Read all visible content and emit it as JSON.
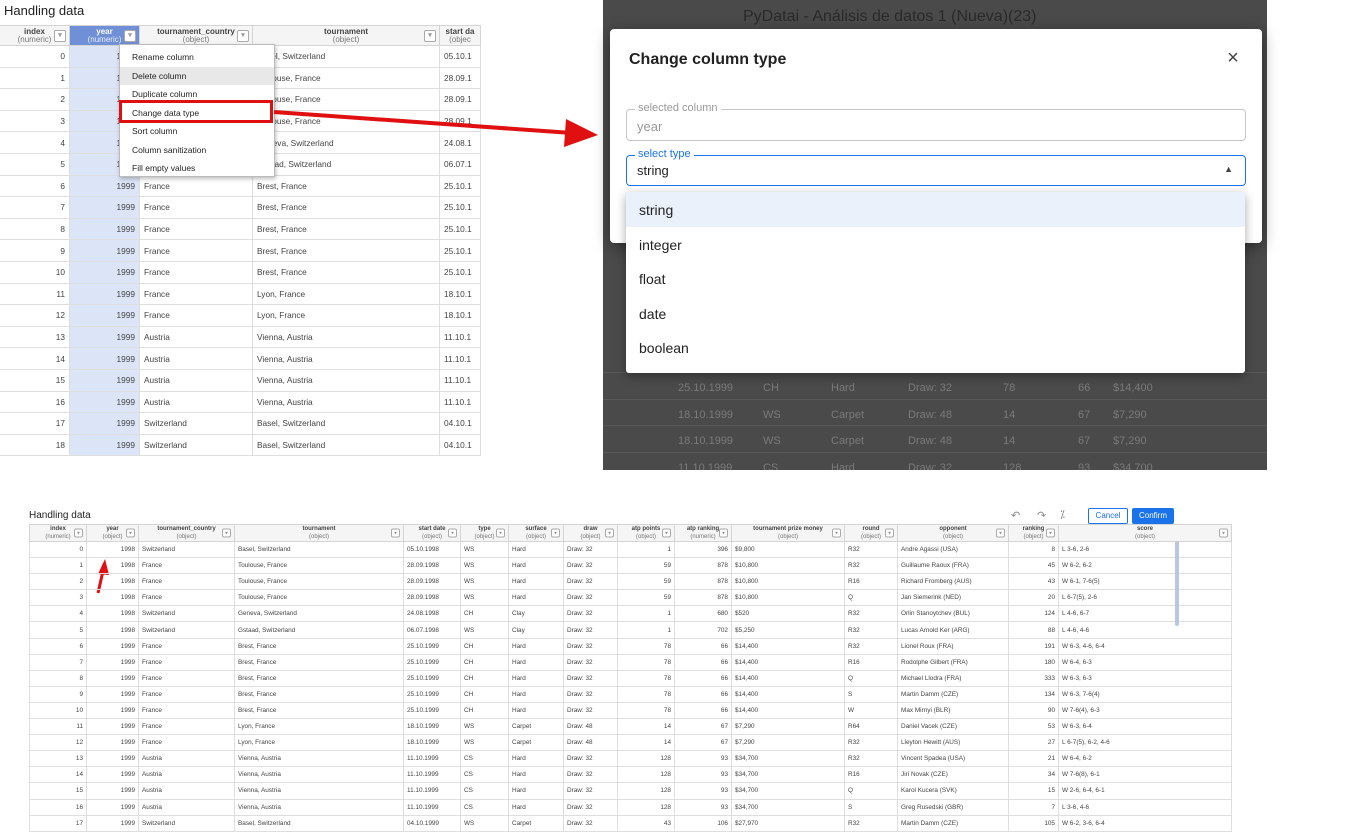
{
  "top_left": {
    "title": "Handling data",
    "columns": [
      {
        "name": "index",
        "type": "(numeric)"
      },
      {
        "name": "year",
        "type": "(numeric)"
      },
      {
        "name": "tournament_country",
        "type": "(object)"
      },
      {
        "name": "tournament",
        "type": "(object)"
      },
      {
        "name": "start da",
        "type": "(objec"
      }
    ],
    "rows": [
      [
        "0",
        "1998",
        "Switzerland",
        "Basel, Switzerland",
        "05.10.1"
      ],
      [
        "1",
        "1998",
        "France",
        "Toulouse, France",
        "28.09.1"
      ],
      [
        "2",
        "1998",
        "France",
        "Toulouse, France",
        "28.09.1"
      ],
      [
        "3",
        "1998",
        "France",
        "Toulouse, France",
        "28.09.1"
      ],
      [
        "4",
        "1998",
        "Switzerland",
        "Geneva, Switzerland",
        "24.08.1"
      ],
      [
        "5",
        "1998",
        "Switzerland",
        "Gstaad, Switzerland",
        "06.07.1"
      ],
      [
        "6",
        "1999",
        "France",
        "Brest, France",
        "25.10.1"
      ],
      [
        "7",
        "1999",
        "France",
        "Brest, France",
        "25.10.1"
      ],
      [
        "8",
        "1999",
        "France",
        "Brest, France",
        "25.10.1"
      ],
      [
        "9",
        "1999",
        "France",
        "Brest, France",
        "25.10.1"
      ],
      [
        "10",
        "1999",
        "France",
        "Brest, France",
        "25.10.1"
      ],
      [
        "11",
        "1999",
        "France",
        "Lyon, France",
        "18.10.1"
      ],
      [
        "12",
        "1999",
        "France",
        "Lyon, France",
        "18.10.1"
      ],
      [
        "13",
        "1999",
        "Austria",
        "Vienna, Austria",
        "11.10.1"
      ],
      [
        "14",
        "1999",
        "Austria",
        "Vienna, Austria",
        "11.10.1"
      ],
      [
        "15",
        "1999",
        "Austria",
        "Vienna, Austria",
        "11.10.1"
      ],
      [
        "16",
        "1999",
        "Austria",
        "Vienna, Austria",
        "11.10.1"
      ],
      [
        "17",
        "1999",
        "Switzerland",
        "Basel, Switzerland",
        "04.10.1"
      ],
      [
        "18",
        "1999",
        "Switzerland",
        "Basel, Switzerland",
        "04.10.1"
      ]
    ],
    "context_menu": [
      "Rename column",
      "Delete column",
      "Duplicate column",
      "Change data type",
      "Sort column",
      "Column sanitization",
      "Fill empty values"
    ],
    "menu_hover_index": 1,
    "highlighted_item_index": 3
  },
  "modal": {
    "background_title": "PyDatai - Análisis de datos 1 (Nueva)(23)",
    "title": "Change column type",
    "close": "×",
    "selected_column_label": "selected column",
    "selected_column_value": "year",
    "select_type_label": "select type",
    "select_type_value": "string",
    "options": [
      "string",
      "integer",
      "float",
      "date",
      "boolean"
    ],
    "background_rows": [
      [
        "25.10.1999",
        "CH",
        "Hard",
        "Draw: 32",
        "78",
        "66",
        "$14,400"
      ],
      [
        "18.10.1999",
        "WS",
        "Carpet",
        "Draw: 48",
        "14",
        "67",
        "$7,290"
      ],
      [
        "18.10.1999",
        "WS",
        "Carpet",
        "Draw: 48",
        "14",
        "67",
        "$7,290"
      ],
      [
        "11.10.1999",
        "CS",
        "Hard",
        "Draw: 32",
        "128",
        "93",
        "$34,700"
      ]
    ]
  },
  "bottom": {
    "title": "Handling data",
    "cancel": "Cancel",
    "confirm": "Confirm",
    "columns": [
      {
        "name": "index",
        "type": "(numeric)"
      },
      {
        "name": "year",
        "type": "(object)"
      },
      {
        "name": "tournament_country",
        "type": "(object)"
      },
      {
        "name": "tournament",
        "type": "(object)"
      },
      {
        "name": "start date",
        "type": "(object)"
      },
      {
        "name": "type",
        "type": "(object)"
      },
      {
        "name": "surface",
        "type": "(object)"
      },
      {
        "name": "draw",
        "type": "(object)"
      },
      {
        "name": "atp points",
        "type": "(object)"
      },
      {
        "name": "atp ranking",
        "type": "(numeric)"
      },
      {
        "name": "tournament prize money",
        "type": "(object)"
      },
      {
        "name": "round",
        "type": "(object)"
      },
      {
        "name": "opponent",
        "type": "(object)"
      },
      {
        "name": "ranking",
        "type": "(object)"
      },
      {
        "name": "score",
        "type": "(object)"
      }
    ],
    "rows": [
      [
        "0",
        "1998",
        "Switzerland",
        "Basel, Switzerland",
        "05.10.1998",
        "WS",
        "Hard",
        "Draw: 32",
        "1",
        "396",
        "$9,800",
        "R32",
        "Andre Agassi (USA)",
        "8",
        "L 3-6, 2-6"
      ],
      [
        "1",
        "1998",
        "France",
        "Toulouse, France",
        "28.09.1998",
        "WS",
        "Hard",
        "Draw: 32",
        "59",
        "878",
        "$10,800",
        "R32",
        "Guillaume Raoux (FRA)",
        "45",
        "W 6-2, 6-2"
      ],
      [
        "2",
        "1998",
        "France",
        "Toulouse, France",
        "28.09.1998",
        "WS",
        "Hard",
        "Draw: 32",
        "59",
        "878",
        "$10,800",
        "R16",
        "Richard Fromberg (AUS)",
        "43",
        "W 6-1, 7-6(5)"
      ],
      [
        "3",
        "1998",
        "France",
        "Toulouse, France",
        "28.09.1998",
        "WS",
        "Hard",
        "Draw: 32",
        "59",
        "878",
        "$10,800",
        "Q",
        "Jan Siemerink (NED)",
        "20",
        "L 6-7(5), 2-6"
      ],
      [
        "4",
        "1998",
        "Switzerland",
        "Geneva, Switzerland",
        "24.08.1998",
        "CH",
        "Clay",
        "Draw: 32",
        "1",
        "680",
        "$520",
        "R32",
        "Orlin Stanoytchev (BUL)",
        "124",
        "L 4-6, 6-7"
      ],
      [
        "5",
        "1998",
        "Switzerland",
        "Gstaad, Switzerland",
        "06.07.1998",
        "WS",
        "Clay",
        "Draw: 32",
        "1",
        "702",
        "$5,250",
        "R32",
        "Lucas Arnold Ker (ARG)",
        "88",
        "L 4-6, 4-6"
      ],
      [
        "6",
        "1999",
        "France",
        "Brest, France",
        "25.10.1999",
        "CH",
        "Hard",
        "Draw: 32",
        "78",
        "66",
        "$14,400",
        "R32",
        "Lionel Roux (FRA)",
        "191",
        "W 6-3, 4-6, 6-4"
      ],
      [
        "7",
        "1999",
        "France",
        "Brest, France",
        "25.10.1999",
        "CH",
        "Hard",
        "Draw: 32",
        "78",
        "66",
        "$14,400",
        "R16",
        "Rodolphe Gilbert (FRA)",
        "180",
        "W 6-4, 6-3"
      ],
      [
        "8",
        "1999",
        "France",
        "Brest, France",
        "25.10.1999",
        "CH",
        "Hard",
        "Draw: 32",
        "78",
        "66",
        "$14,400",
        "Q",
        "Michael Llodra (FRA)",
        "333",
        "W 6-3, 6-3"
      ],
      [
        "9",
        "1999",
        "France",
        "Brest, France",
        "25.10.1999",
        "CH",
        "Hard",
        "Draw: 32",
        "78",
        "66",
        "$14,400",
        "S",
        "Martin Damm (CZE)",
        "134",
        "W 6-3, 7-6(4)"
      ],
      [
        "10",
        "1999",
        "France",
        "Brest, France",
        "25.10.1999",
        "CH",
        "Hard",
        "Draw: 32",
        "78",
        "66",
        "$14,400",
        "W",
        "Max Mirnyi (BLR)",
        "90",
        "W 7-6(4), 6-3"
      ],
      [
        "11",
        "1999",
        "France",
        "Lyon, France",
        "18.10.1999",
        "WS",
        "Carpet",
        "Draw: 48",
        "14",
        "67",
        "$7,290",
        "R64",
        "Daniel Vacek (CZE)",
        "53",
        "W 6-3, 6-4"
      ],
      [
        "12",
        "1999",
        "France",
        "Lyon, France",
        "18.10.1999",
        "WS",
        "Carpet",
        "Draw: 48",
        "14",
        "67",
        "$7,290",
        "R32",
        "Lleyton Hewitt (AUS)",
        "27",
        "L 6-7(5), 6-2, 4-6"
      ],
      [
        "13",
        "1999",
        "Austria",
        "Vienna, Austria",
        "11.10.1999",
        "CS",
        "Hard",
        "Draw: 32",
        "128",
        "93",
        "$34,700",
        "R32",
        "Vincent Spadea (USA)",
        "21",
        "W 6-4, 6-2"
      ],
      [
        "14",
        "1999",
        "Austria",
        "Vienna, Austria",
        "11.10.1999",
        "CS",
        "Hard",
        "Draw: 32",
        "128",
        "93",
        "$34,700",
        "R16",
        "Jiri Novak (CZE)",
        "34",
        "W 7-6(8), 6-1"
      ],
      [
        "15",
        "1999",
        "Austria",
        "Vienna, Austria",
        "11.10.1999",
        "CS",
        "Hard",
        "Draw: 32",
        "128",
        "93",
        "$34,700",
        "Q",
        "Karol Kucera (SVK)",
        "15",
        "W 2-6, 6-4, 6-1"
      ],
      [
        "16",
        "1999",
        "Austria",
        "Vienna, Austria",
        "11.10.1999",
        "CS",
        "Hard",
        "Draw: 32",
        "128",
        "93",
        "$34,700",
        "S",
        "Greg Rusedski (GBR)",
        "7",
        "L 3-6, 4-6"
      ],
      [
        "17",
        "1999",
        "Switzerland",
        "Basel, Switzerland",
        "04.10.1999",
        "WS",
        "Carpet",
        "Draw: 32",
        "43",
        "106",
        "$27,970",
        "R32",
        "Martin Damm (CZE)",
        "105",
        "W 6-2, 3-6, 6-4"
      ]
    ]
  },
  "icons": {
    "undo": "undo-icon",
    "redo": "redo-icon",
    "magic": "magic-wand-icon"
  },
  "colors": {
    "accent": "#1a73e8",
    "annotation": "#e01010",
    "selected_column": "#dbe5f7"
  }
}
